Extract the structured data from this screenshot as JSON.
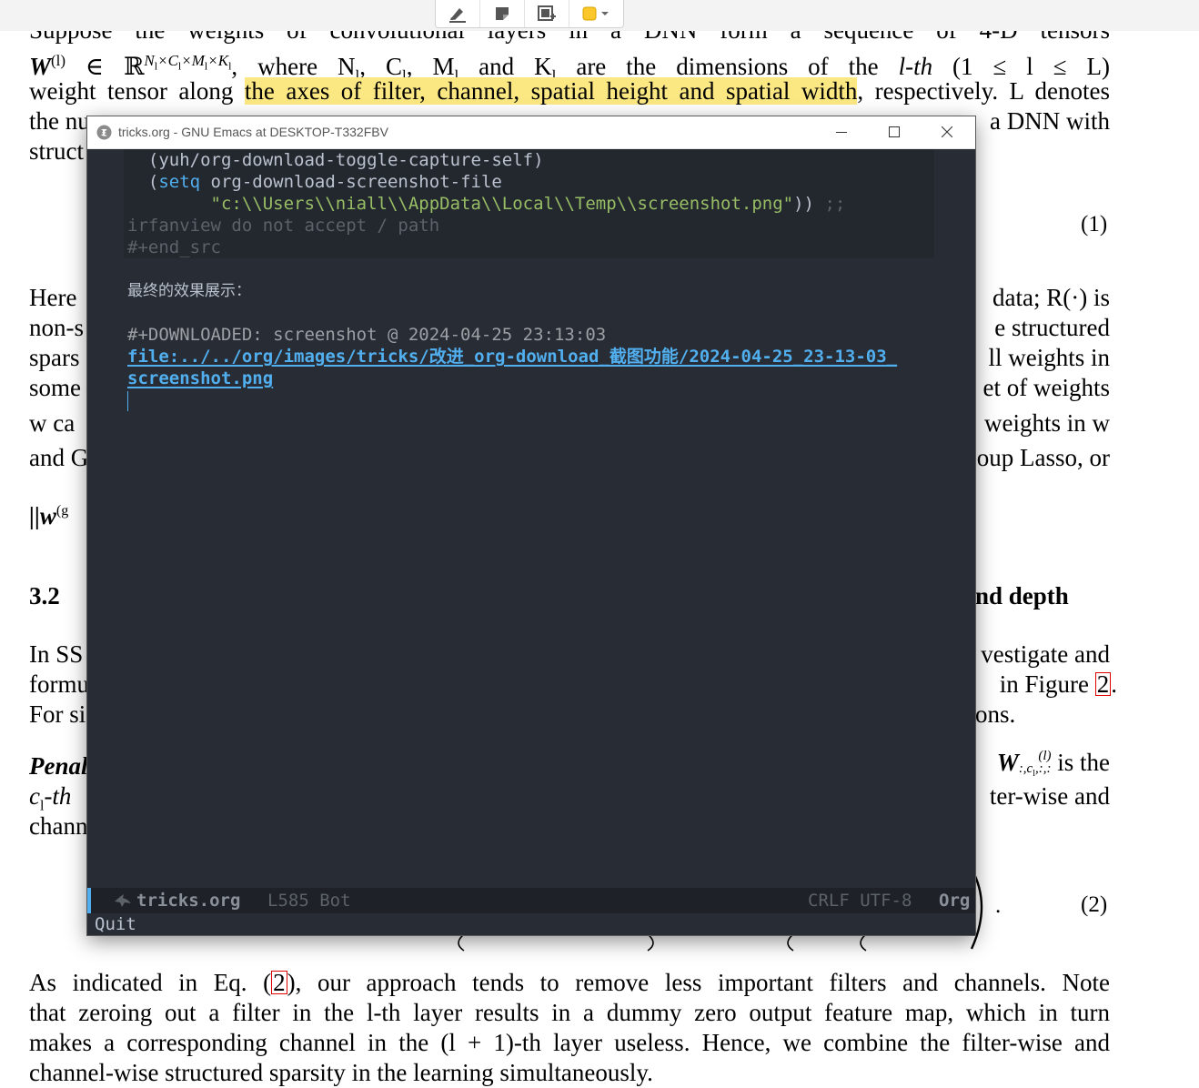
{
  "toolbar": {
    "tools": [
      {
        "icon": "highlighter-icon"
      },
      {
        "icon": "note-icon"
      },
      {
        "icon": "textbox-icon"
      },
      {
        "icon": "color-picker-icon",
        "color": "#fcc72b"
      }
    ]
  },
  "pdf": {
    "line0": "Suppose the weights of convolutional layers in a DNN form a sequence of 4-D tensors",
    "line1a": "W",
    "line1b": "(l)",
    "line1c": " ∈ ℝ",
    "line1d": "N",
    "line1e": "l",
    "line1f": "×C",
    "line1g": "l",
    "line1h": "×M",
    "line1i": "l",
    "line1j": "×K",
    "line1k": "l",
    "line1l": ", where N",
    "line1m": "l",
    "line1n": ", C",
    "line1o": "l",
    "line1p": ", M",
    "line1q": "l",
    "line1r": " and K",
    "line1s": "l",
    "line1t": " are the dimensions of the ",
    "line1u": "l-th",
    "line1v": " (1 ≤ l ≤ L)",
    "line2a": "weight tensor along ",
    "line2b": "the axes of filter, channel, spatial height and spatial width",
    "line2c": ", respectively. L denotes",
    "line3a": "the nu",
    "line3b": "a DNN with",
    "line4a": "struct",
    "eq1": "(1)",
    "line5a": "Here",
    "line5b": "data; R(·) is",
    "line6a": "non-s",
    "line6b": "e structured",
    "line7a": "spars",
    "line7b": "ll weights in",
    "line8a": "some",
    "line8b": "et of weights",
    "line9a": "w ca",
    "line9b": "weights in w",
    "line10a": "and G",
    "line10b": "oup Lasso, or",
    "line11a": "||w",
    "line11b": "(g",
    "sec_num": "3.2",
    "sec_tail": "nd depth",
    "line12a": "In SS",
    "line12b": "vestigate and",
    "line13a": "formu",
    "line13b": "in Figure ",
    "line13c": "2",
    "line13d": ".",
    "line14a": "For si",
    "line14b": "ons.",
    "line15a": "Penal",
    "line15b": "W",
    "line15c": "(l)",
    "line15d": ":,c",
    "line15e": "l",
    "line15f": ",:,:",
    "line15g": " is the",
    "line16a": "c",
    "line16b": "l",
    "line16c": "-th",
    "line16d": "ter-wise and",
    "line17a": "chann",
    "eq2": "(2)",
    "eq2_dot": ".",
    "para_a": "As indicated in Eq. (",
    "para_ref": "2",
    "para_b": "), our approach tends to remove less important filters and channels.  Note",
    "para2": "that zeroing out a filter in the l-th layer results in a dummy zero output feature map, which in turn",
    "para3": "makes a corresponding channel in the (l + 1)-th layer useless. Hence, we combine the filter-wise and",
    "para4": "channel-wise structured sparsity in the learning simultaneously."
  },
  "emacs": {
    "window_title": "tricks.org - GNU Emacs at DESKTOP-T332FBV",
    "code": {
      "l1": "  (yuh/org-download-toggle-capture-self)",
      "l2_open": "  (",
      "l2_kw": "setq",
      "l2_rest": " org-download-screenshot-file",
      "l3_indent": "        ",
      "l3_str": "\"c:\\\\Users\\\\niall\\\\AppData\\\\Local\\\\Temp\\\\screenshot.png\"",
      "l3_close": ")) ",
      "l3_cmt": ";;",
      "l4": "irfanview do not accept / path",
      "l5": "#+end_src"
    },
    "heading": "最终的效果展示：",
    "downloaded": "#+DOWNLOADED: screenshot @ 2024-04-25 23:13:03",
    "link1": "file:../../org/images/tricks/改进_org-download_截图功能/2024-04-25_23-13-03_",
    "link2": "screenshot.png",
    "modeline": {
      "buffer": "tricks.org",
      "position": "L585 Bot",
      "encoding": "CRLF UTF-8",
      "mode": "Org"
    },
    "minibuffer": "Quit"
  }
}
